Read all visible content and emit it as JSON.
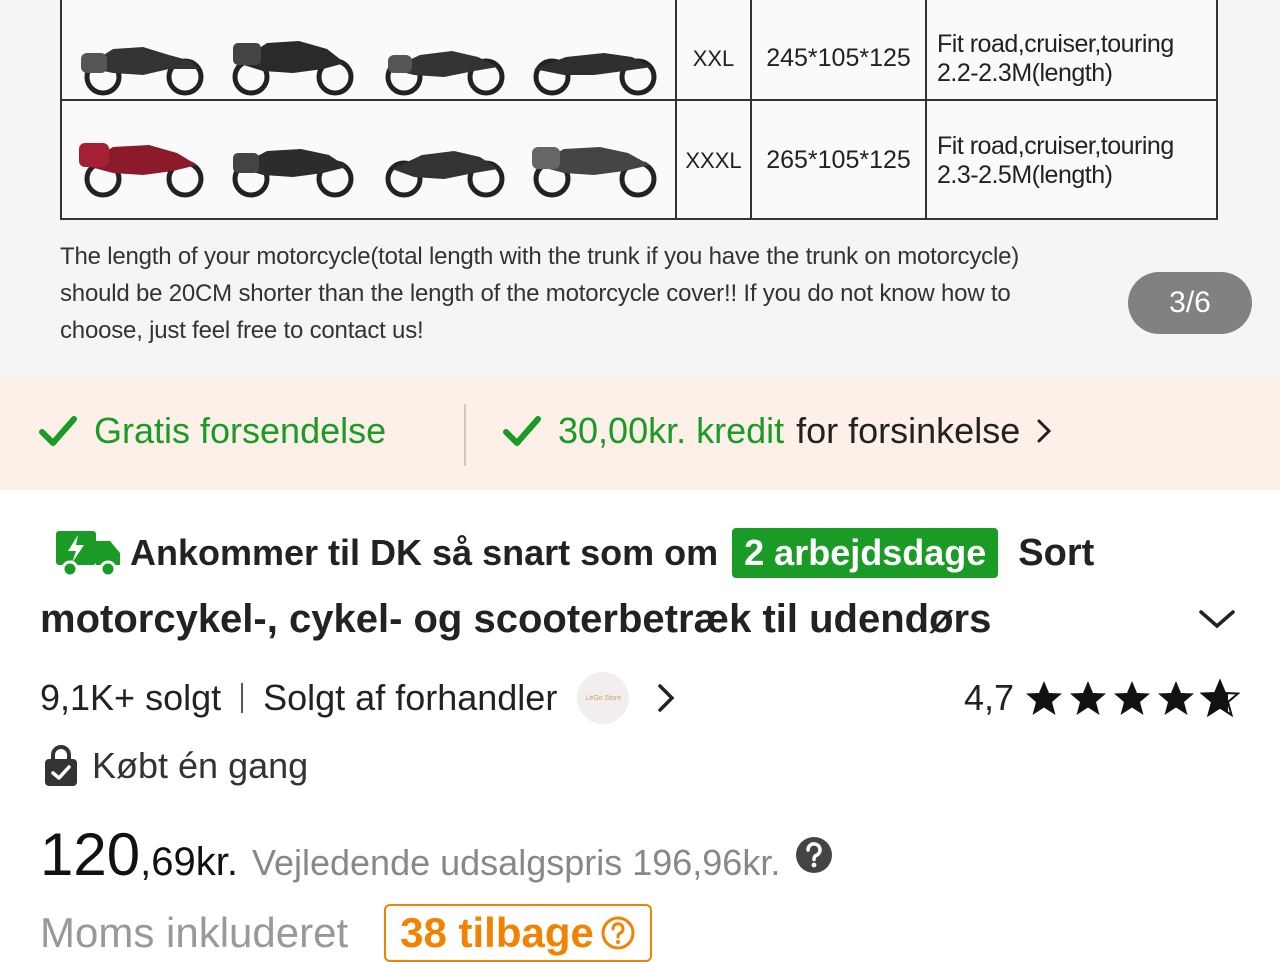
{
  "hero": {
    "rows": [
      {
        "size": "XXL",
        "dims": "245*105*125",
        "fit_line1": "Fit road,cruiser,touring",
        "fit_line2": "2.2-2.3M(length)"
      },
      {
        "size": "XXXL",
        "dims": "265*105*125",
        "fit_line1": "Fit road,cruiser,touring",
        "fit_line2": "2.3-2.5M(length)"
      }
    ],
    "note_line1": "The length of your motorcycle(total length with the trunk if you have the trunk on motorcycle)",
    "note_line2": "should be 20CM shorter than the length of the motorcycle cover!! If you do not know how to",
    "note_line3": "choose, just feel free to contact us!",
    "page_indicator": "3/6"
  },
  "benefits": {
    "free_shipping": "Gratis forsendelse",
    "credit_amount": "30,00kr. kredit",
    "credit_suffix": "for forsinkelse"
  },
  "title": {
    "arrive_text": "Ankommer til DK så snart som om",
    "arrive_badge": "2 arbejdsdage",
    "title_start": "Sort",
    "title_rest": "motorcykel-, cykel- og scooterbetræk til udendørs"
  },
  "meta": {
    "sold": "9,1K+ solgt",
    "seller_label": "Solgt af forhandler",
    "seller_logo_text": "LeGo Store",
    "rating": "4,7",
    "stars": 4.7
  },
  "bought": {
    "label": "Købt én gang"
  },
  "price": {
    "integer": "120",
    "decimal": ",69",
    "unit": "kr.",
    "reference": "Vejledende udsalgspris 196,96kr."
  },
  "vat": {
    "label": "Moms inkluderet",
    "stock": "38 tilbage"
  },
  "colors": {
    "green": "#1a9b26",
    "orange": "#f08300",
    "benefit_bg": "#fdf0e8"
  }
}
